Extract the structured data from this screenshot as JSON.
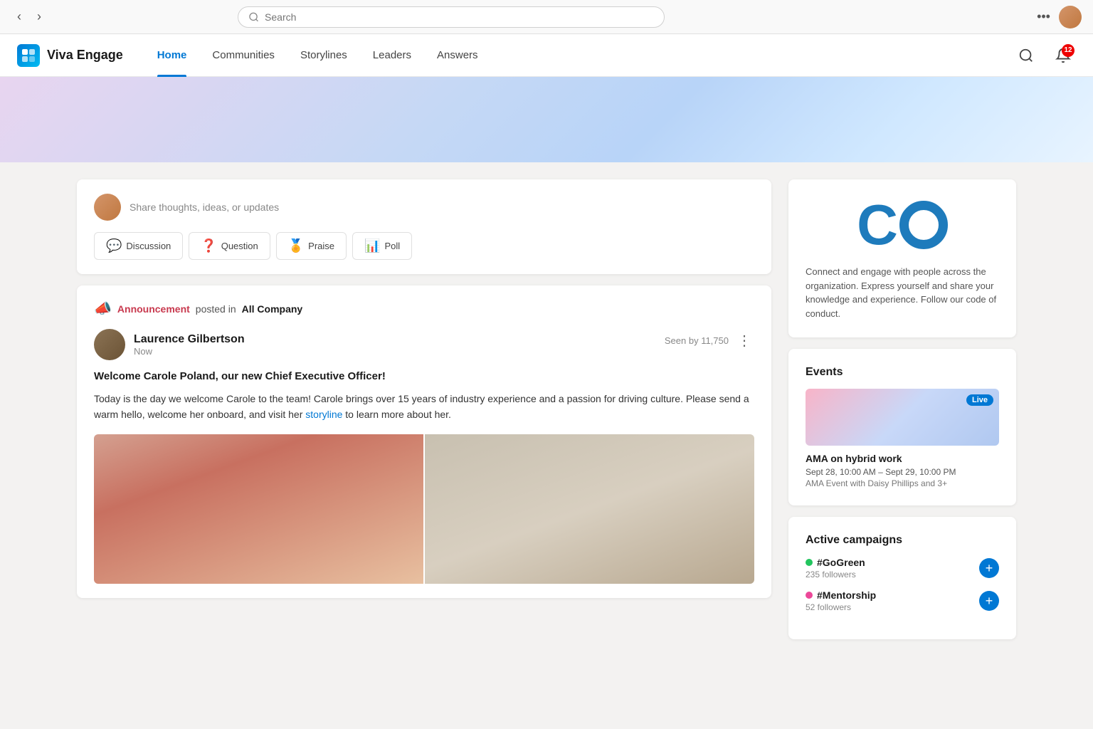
{
  "browser": {
    "search_placeholder": "Search",
    "more_label": "•••"
  },
  "header": {
    "app_name": "Viva Engage",
    "nav": [
      {
        "id": "home",
        "label": "Home",
        "active": true
      },
      {
        "id": "communities",
        "label": "Communities",
        "active": false
      },
      {
        "id": "storylines",
        "label": "Storylines",
        "active": false
      },
      {
        "id": "leaders",
        "label": "Leaders",
        "active": false
      },
      {
        "id": "answers",
        "label": "Answers",
        "active": false
      }
    ],
    "notification_count": "12"
  },
  "composer": {
    "placeholder": "Share thoughts, ideas, or updates",
    "buttons": [
      {
        "id": "discussion",
        "label": "Discussion"
      },
      {
        "id": "question",
        "label": "Question"
      },
      {
        "id": "praise",
        "label": "Praise"
      },
      {
        "id": "poll",
        "label": "Poll"
      }
    ]
  },
  "post": {
    "announcement_label": "Announcement",
    "posted_in": "posted in",
    "community": "All Company",
    "author": "Laurence Gilbertson",
    "time": "Now",
    "seen_by": "Seen by 11,750",
    "title": "Welcome Carole Poland, our new Chief Executive Officer!",
    "body_part1": "Today is the day we welcome Carole to the team! Carole brings over 15 years of industry experience and a passion for driving culture. Please send a warm hello, welcome her onboard, and visit her",
    "body_link": "storyline",
    "body_part2": "to learn more about her."
  },
  "co_card": {
    "logo_c": "C",
    "description": "Connect and engage with people across the organization. Express yourself and share your knowledge and experience. Follow our code of conduct."
  },
  "events": {
    "title": "Events",
    "item": {
      "live_label": "Live",
      "name": "AMA on hybrid work",
      "date": "Sept 28, 10:00 AM – Sept 29, 10:00 PM",
      "desc": "AMA Event with Daisy Phillips and 3+"
    }
  },
  "campaigns": {
    "title": "Active campaigns",
    "items": [
      {
        "name": "#GoGreen",
        "dot_class": "dot-green",
        "followers": "235 followers"
      },
      {
        "name": "#Mentorship",
        "dot_class": "dot-pink",
        "followers": "52 followers"
      }
    ]
  }
}
